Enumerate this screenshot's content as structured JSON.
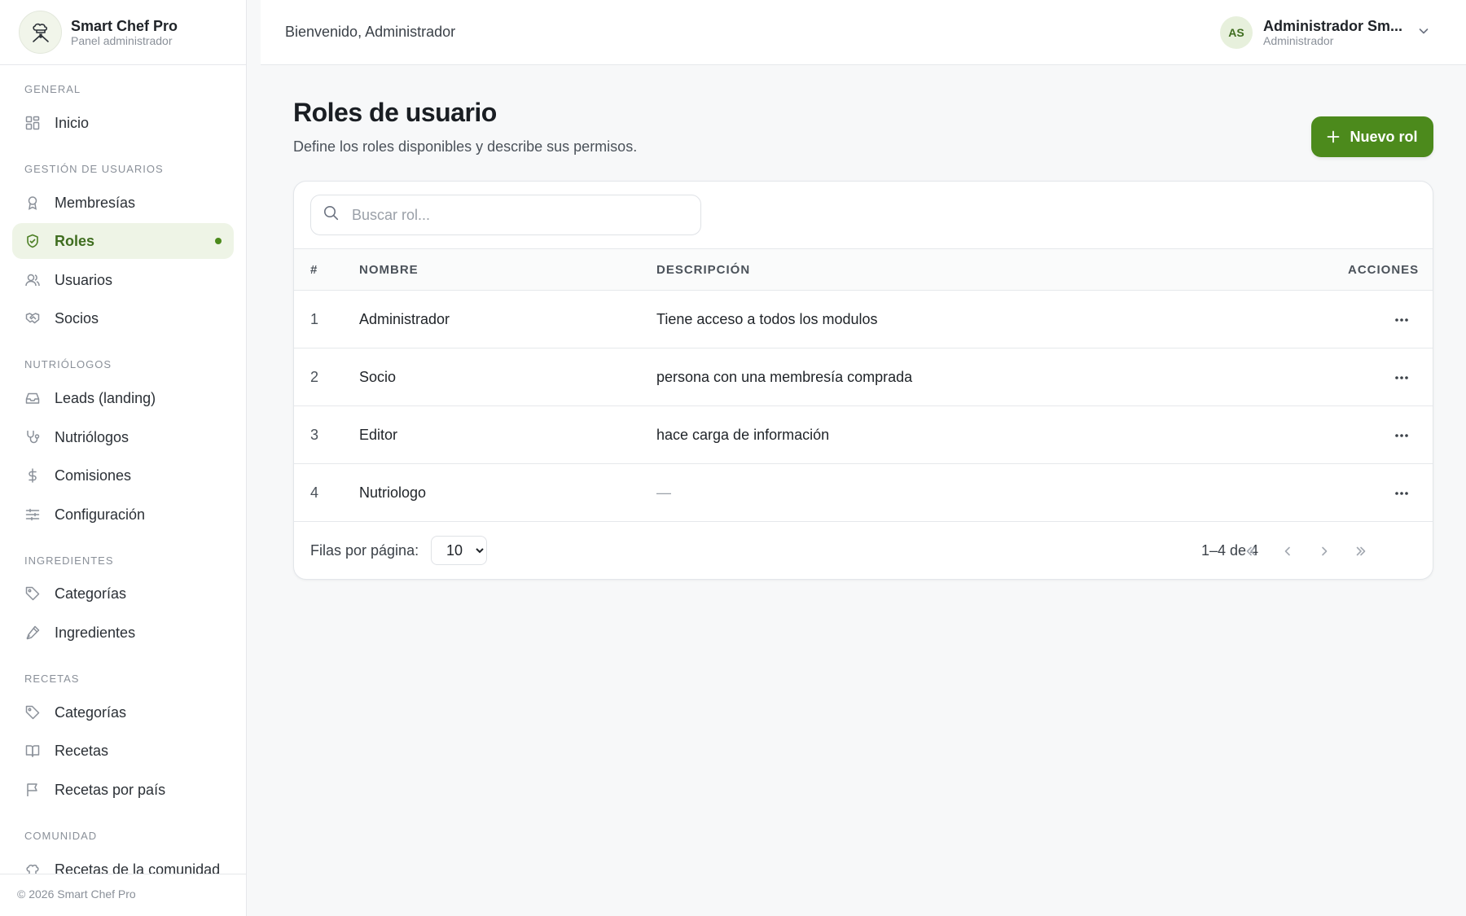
{
  "brand": {
    "name": "Smart Chef Pro",
    "subtitle": "Panel administrador"
  },
  "sidebar": {
    "sections": [
      {
        "title": "GENERAL",
        "items": [
          {
            "label": "Inicio",
            "icon": "grid-icon"
          }
        ]
      },
      {
        "title": "GESTIÓN DE USUARIOS",
        "items": [
          {
            "label": "Membresías",
            "icon": "award-icon"
          },
          {
            "label": "Roles",
            "icon": "shield-check-icon",
            "active": true
          },
          {
            "label": "Usuarios",
            "icon": "users-icon"
          },
          {
            "label": "Socios",
            "icon": "handshake-icon"
          }
        ]
      },
      {
        "title": "NUTRIÓLOGOS",
        "items": [
          {
            "label": "Leads (landing)",
            "icon": "inbox-icon"
          },
          {
            "label": "Nutriólogos",
            "icon": "stethoscope-icon"
          },
          {
            "label": "Comisiones",
            "icon": "dollar-icon"
          },
          {
            "label": "Configuración",
            "icon": "sliders-icon"
          }
        ]
      },
      {
        "title": "INGREDIENTES",
        "items": [
          {
            "label": "Categorías",
            "icon": "tag-icon"
          },
          {
            "label": "Ingredientes",
            "icon": "pen-icon"
          }
        ]
      },
      {
        "title": "RECETAS",
        "items": [
          {
            "label": "Categorías",
            "icon": "tag-icon"
          },
          {
            "label": "Recetas",
            "icon": "book-icon"
          },
          {
            "label": "Recetas por país",
            "icon": "flag-icon"
          }
        ]
      },
      {
        "title": "COMUNIDAD",
        "items": [
          {
            "label": "Recetas de la comunidad",
            "icon": "chef-hat-icon"
          }
        ]
      }
    ],
    "footer": "© 2026 Smart Chef Pro"
  },
  "header": {
    "welcome": "Bienvenido, Administrador",
    "user": {
      "initials": "AS",
      "name": "Administrador Sm...",
      "role": "Administrador"
    }
  },
  "main": {
    "title": "Roles de usuario",
    "subtitle": "Define los roles disponibles y describe sus permisos.",
    "new_button_label": "Nuevo rol",
    "search_placeholder": "Buscar rol...",
    "table": {
      "columns": {
        "num": "#",
        "name": "NOMBRE",
        "description": "DESCRIPCIÓN",
        "actions": "ACCIONES"
      },
      "rows": [
        {
          "num": "1",
          "name": "Administrador",
          "description": "Tiene acceso a todos los modulos"
        },
        {
          "num": "2",
          "name": "Socio",
          "description": "persona con una membresía comprada"
        },
        {
          "num": "3",
          "name": "Editor",
          "description": "hace carga de información"
        },
        {
          "num": "4",
          "name": "Nutriologo",
          "description": "—"
        }
      ]
    },
    "pagination": {
      "rows_per_page_label": "Filas por página:",
      "rows_per_page_value": "10",
      "range": "1–4 de 4"
    }
  },
  "colors": {
    "accent": "#4c8a1c",
    "active_bg": "#eef4e6",
    "active_text": "#3f6d1f"
  }
}
